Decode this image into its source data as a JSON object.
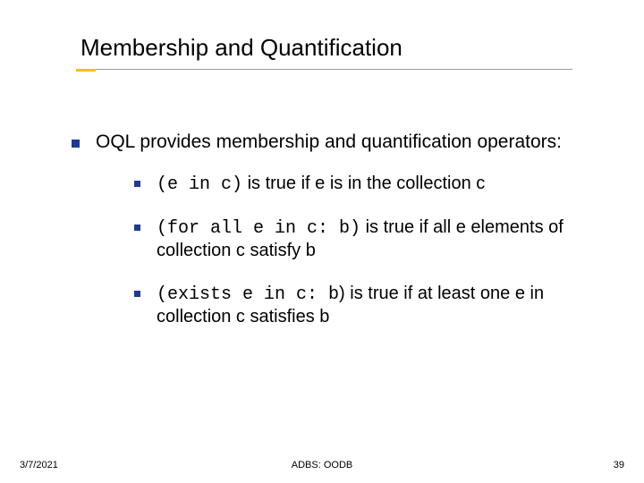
{
  "title": "Membership and Quantification",
  "main": {
    "intro": "OQL provides membership and quantification operators:",
    "items": [
      {
        "code": "(e in c)",
        "rest": " is true if e is in the collection c"
      },
      {
        "code": "(for all e in c: b)",
        "rest": " is true if all e elements of collection c satisfy b"
      },
      {
        "code": "(exists e in c: b",
        "close": ")",
        "rest": " is true if at least one e in collection c satisfies b"
      }
    ]
  },
  "footer": {
    "date": "3/7/2021",
    "center": "ADBS: OODB",
    "page": "39"
  }
}
